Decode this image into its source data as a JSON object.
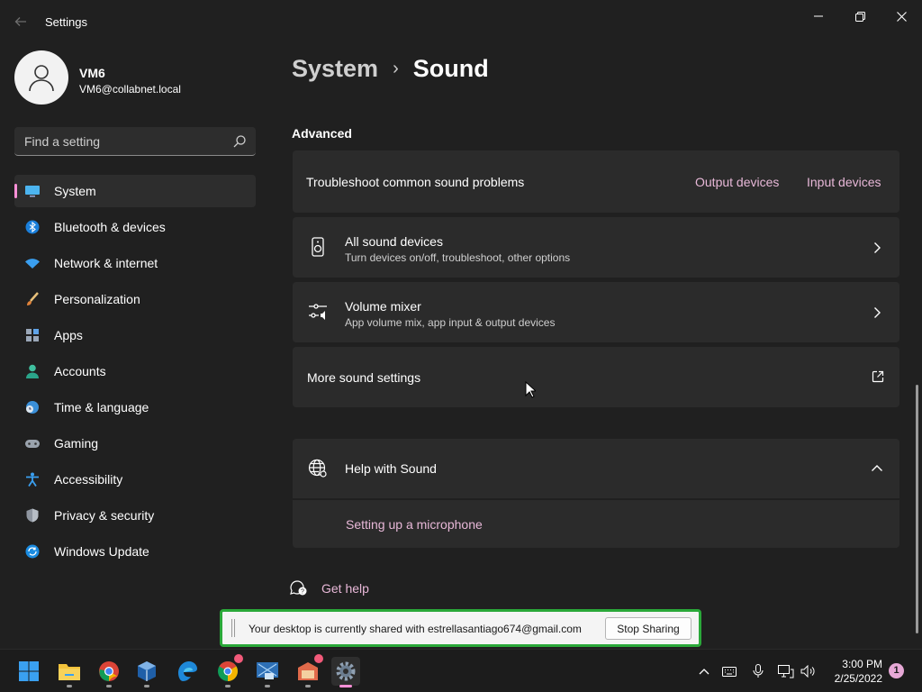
{
  "window": {
    "title": "Settings",
    "back_icon": "back-arrow-icon",
    "minimize_icon": "minimize-icon",
    "maximize_icon": "restore-icon",
    "close_icon": "close-icon"
  },
  "profile": {
    "name": "VM6",
    "email": "VM6@collabnet.local"
  },
  "search": {
    "placeholder": "Find a setting",
    "value": ""
  },
  "sidebar": {
    "items": [
      {
        "label": "System",
        "icon": "monitor-icon",
        "active": true
      },
      {
        "label": "Bluetooth & devices",
        "icon": "bluetooth-icon"
      },
      {
        "label": "Network & internet",
        "icon": "wifi-icon"
      },
      {
        "label": "Personalization",
        "icon": "brush-icon"
      },
      {
        "label": "Apps",
        "icon": "apps-icon"
      },
      {
        "label": "Accounts",
        "icon": "person-icon"
      },
      {
        "label": "Time & language",
        "icon": "clock-globe-icon"
      },
      {
        "label": "Gaming",
        "icon": "gamepad-icon"
      },
      {
        "label": "Accessibility",
        "icon": "accessibility-icon"
      },
      {
        "label": "Privacy & security",
        "icon": "shield-icon"
      },
      {
        "label": "Windows Update",
        "icon": "update-icon"
      }
    ]
  },
  "breadcrumb": {
    "parent": "System",
    "separator": "›",
    "current": "Sound"
  },
  "main": {
    "section_title": "Advanced",
    "troubleshoot": {
      "label": "Troubleshoot common sound problems",
      "output_link": "Output devices",
      "input_link": "Input devices"
    },
    "all_devices": {
      "title": "All sound devices",
      "subtitle": "Turn devices on/off, troubleshoot, other options"
    },
    "volume_mixer": {
      "title": "Volume mixer",
      "subtitle": "App volume mix, app input & output devices"
    },
    "more_settings": {
      "title": "More sound settings"
    },
    "help": {
      "title": "Help with Sound",
      "link": "Setting up a microphone"
    },
    "get_help": "Get help"
  },
  "share_bar": {
    "message": "Your desktop is currently shared with estrellasantiago674@gmail.com",
    "stop_label": "Stop Sharing"
  },
  "taskbar": {
    "apps": [
      "start-icon",
      "file-explorer-icon",
      "chrome-icon",
      "virtualbox-icon",
      "edge-icon",
      "chrome-profile-icon",
      "network-app-icon",
      "remote-desktop-icon",
      "settings-icon"
    ],
    "time": "3:00 PM",
    "date": "2/25/2022",
    "notification_count": "1"
  },
  "colors": {
    "accent": "#ff90d7",
    "link": "#e8b8d8",
    "share_border": "#2aa839",
    "background": "#202020",
    "card": "#2b2b2b"
  }
}
